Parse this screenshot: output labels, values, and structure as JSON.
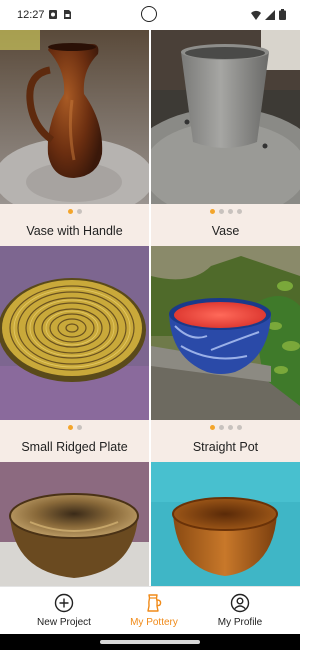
{
  "status_bar": {
    "time": "12:27"
  },
  "cards": [
    {
      "title": "Vase with Handle",
      "dots": 2,
      "active_dot": 0,
      "image": "brown glazed vase with handle on wheel"
    },
    {
      "title": "Vase",
      "dots": 4,
      "active_dot": 0,
      "image": "grey clay vase on wheel"
    },
    {
      "title": "Small Ridged Plate",
      "dots": 2,
      "active_dot": 0,
      "image": "yellow ridged plate"
    },
    {
      "title": "Straight Pot",
      "dots": 4,
      "active_dot": 0,
      "image": "red and blue bowl on garden wall"
    },
    {
      "title": "",
      "image": "tan bowl on white stand"
    },
    {
      "title": "",
      "image": "amber bowl on teal background"
    }
  ],
  "bottom_nav": {
    "items": [
      {
        "label": "New Project",
        "icon": "plus-circle-icon"
      },
      {
        "label": "My Pottery",
        "icon": "mug-icon",
        "active": true
      },
      {
        "label": "My Profile",
        "icon": "profile-icon"
      }
    ]
  },
  "colors": {
    "accent": "#f08a18",
    "dot_active": "#f3a52b",
    "card_meta_bg": "#f6ece6"
  }
}
